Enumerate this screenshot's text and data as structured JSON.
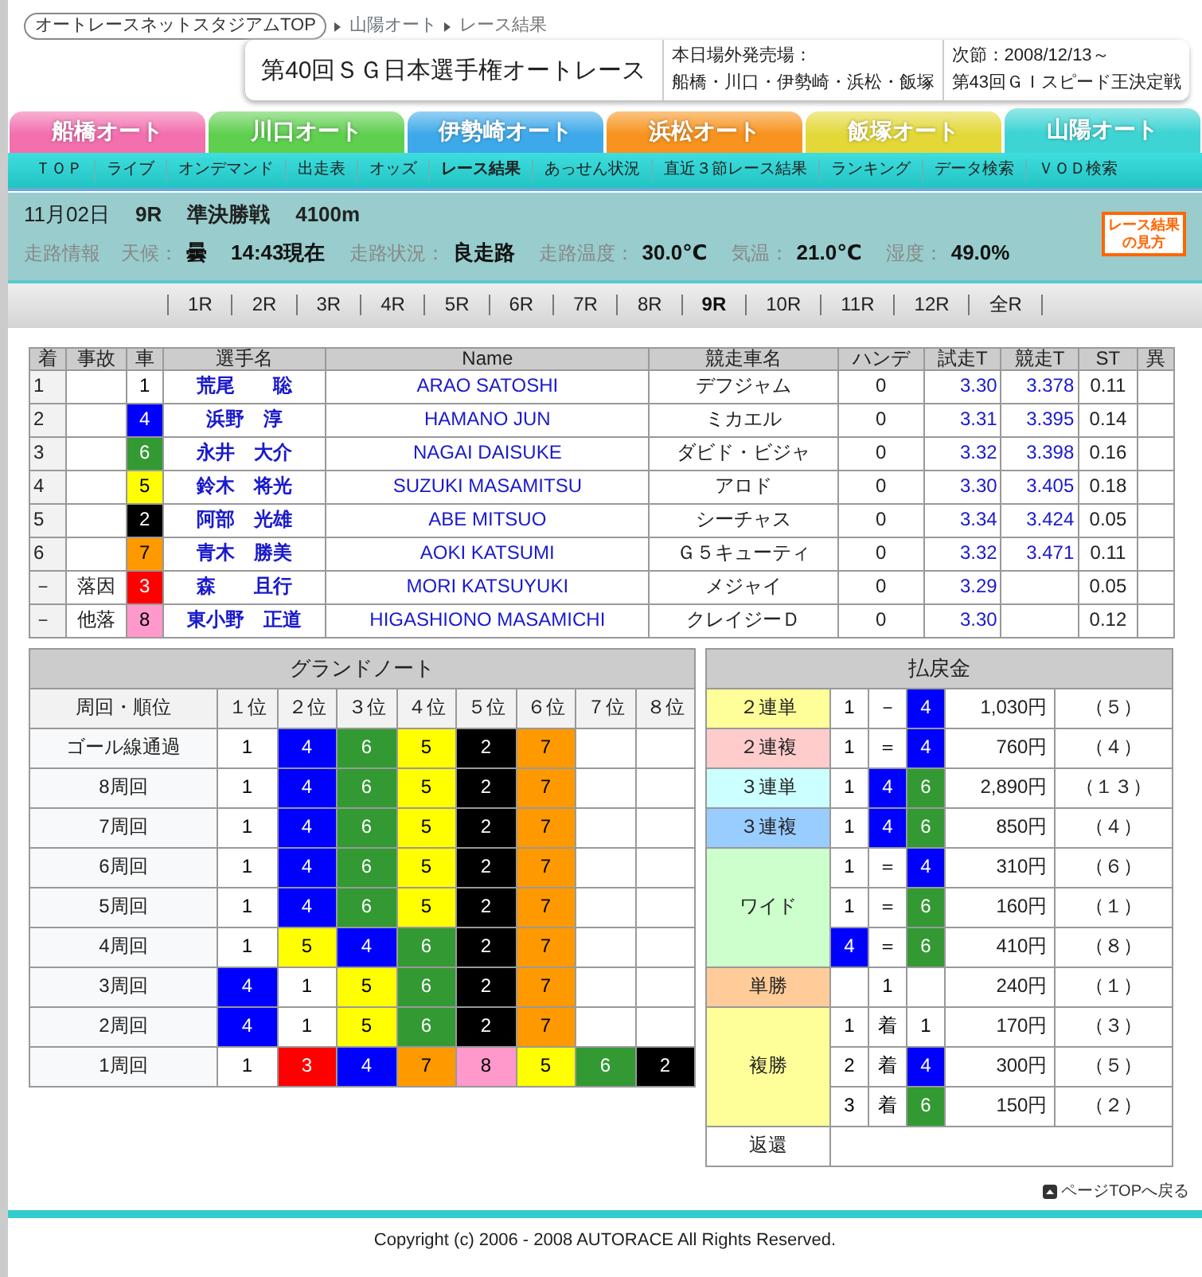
{
  "breadcrumb": [
    "オートレースネットスタジアムTOP",
    "山陽オート",
    "レース結果"
  ],
  "header": {
    "title": "第40回ＳＧ日本選手権オートレース",
    "sales_label": "本日場外発売場：",
    "sales_venues": "船橋・川口・伊勢崎・浜松・飯塚",
    "next_label": "次節：2008/12/13～",
    "next_race": "第43回ＧＩスピード王決定戦"
  },
  "venue_tabs": [
    {
      "label": "船橋オート",
      "color": "#f36fae",
      "selected": false
    },
    {
      "label": "川口オート",
      "color": "#5fcf4f",
      "selected": false
    },
    {
      "label": "伊勢崎オート",
      "color": "#3ea9ea",
      "selected": false
    },
    {
      "label": "浜松オート",
      "color": "#f7931e",
      "selected": false
    },
    {
      "label": "飯塚オート",
      "color": "#e3d838",
      "selected": false
    },
    {
      "label": "山陽オート",
      "color": "#3fd4d4",
      "selected": true
    }
  ],
  "subnav": [
    {
      "label": "ＴＯＰ",
      "selected": false
    },
    {
      "label": "ライブ",
      "selected": false
    },
    {
      "label": "オンデマンド",
      "selected": false
    },
    {
      "label": "出走表",
      "selected": false
    },
    {
      "label": "オッズ",
      "selected": false
    },
    {
      "label": "レース結果",
      "selected": true
    },
    {
      "label": "あっせん状況",
      "selected": false
    },
    {
      "label": "直近３節レース結果",
      "selected": false
    },
    {
      "label": "ランキング",
      "selected": false
    },
    {
      "label": "データ検索",
      "selected": false
    },
    {
      "label": "ＶＯＤ検索",
      "selected": false
    }
  ],
  "race_info": {
    "date": "11月02日",
    "race": "9R",
    "grade": "準決勝戦",
    "distance": "4100m"
  },
  "track_info": {
    "label": "走路情報",
    "items": [
      {
        "kind": "label",
        "text": "天候："
      },
      {
        "kind": "value",
        "text": "曇"
      },
      {
        "kind": "value",
        "text": "14:43現在"
      },
      {
        "kind": "label",
        "text": "走路状況："
      },
      {
        "kind": "value",
        "text": "良走路"
      },
      {
        "kind": "label",
        "text": "走路温度："
      },
      {
        "kind": "value",
        "text": "30.0℃"
      },
      {
        "kind": "label",
        "text": "気温："
      },
      {
        "kind": "value",
        "text": "21.0℃"
      },
      {
        "kind": "label",
        "text": "湿度："
      },
      {
        "kind": "value",
        "text": "49.0%"
      }
    ]
  },
  "guide_button": [
    "レース結果",
    "の見方"
  ],
  "race_tabs": [
    {
      "label": "1R",
      "selected": false
    },
    {
      "label": "2R",
      "selected": false
    },
    {
      "label": "3R",
      "selected": false
    },
    {
      "label": "4R",
      "selected": false
    },
    {
      "label": "5R",
      "selected": false
    },
    {
      "label": "6R",
      "selected": false
    },
    {
      "label": "7R",
      "selected": false
    },
    {
      "label": "8R",
      "selected": false
    },
    {
      "label": "9R",
      "selected": true
    },
    {
      "label": "10R",
      "selected": false
    },
    {
      "label": "11R",
      "selected": false
    },
    {
      "label": "12R",
      "selected": false
    },
    {
      "label": "全R",
      "selected": false
    }
  ],
  "results": {
    "columns": [
      "着",
      "事故",
      "車",
      "選手名",
      "Name",
      "競走車名",
      "ハンデ",
      "試走T",
      "競走T",
      "ST",
      "異"
    ],
    "rows": [
      {
        "finish": "1",
        "car": "1",
        "color": "#ffffff",
        "name_ja": "荒尾　　聡",
        "name_en": "ARAO SATOSHI",
        "bike": "デフジャム",
        "handicap": "0",
        "trial_time": "3.30",
        "race_time": "3.378",
        "st": "0.11"
      },
      {
        "finish": "2",
        "car": "4",
        "color": "#0000ff",
        "name_ja": "浜野　淳",
        "name_en": "HAMANO JUN",
        "bike": "ミカエル",
        "handicap": "0",
        "trial_time": "3.31",
        "race_time": "3.395",
        "st": "0.14"
      },
      {
        "finish": "3",
        "car": "6",
        "color": "#339933",
        "name_ja": "永井　大介",
        "name_en": "NAGAI DAISUKE",
        "bike": "ダビド・ビジャ",
        "handicap": "0",
        "trial_time": "3.32",
        "race_time": "3.398",
        "st": "0.16"
      },
      {
        "finish": "4",
        "car": "5",
        "color": "#ffff00",
        "name_ja": "鈴木　将光",
        "name_en": "SUZUKI MASAMITSU",
        "bike": "アロド",
        "handicap": "0",
        "trial_time": "3.30",
        "race_time": "3.405",
        "st": "0.18"
      },
      {
        "finish": "5",
        "car": "2",
        "color": "#000000",
        "name_ja": "阿部　光雄",
        "name_en": "ABE MITSUO",
        "bike": "シーチャス",
        "handicap": "0",
        "trial_time": "3.34",
        "race_time": "3.424",
        "st": "0.05"
      },
      {
        "finish": "6",
        "car": "7",
        "color": "#ff9900",
        "name_ja": "青木　勝美",
        "name_en": "AOKI KATSUMI",
        "bike": "Ｇ５キューティ",
        "handicap": "0",
        "trial_time": "3.32",
        "race_time": "3.471",
        "st": "0.11"
      },
      {
        "finish": "－",
        "accident": "落因",
        "car": "3",
        "color": "#ff0000",
        "name_ja": "森　　且行",
        "name_en": "MORI KATSUYUKI",
        "bike": "メジャイ",
        "handicap": "0",
        "trial_time": "3.29",
        "st": "0.05"
      },
      {
        "finish": "－",
        "accident": "他落",
        "car": "8",
        "color": "#ff99cc",
        "name_ja": "東小野　正道",
        "name_en": "HIGASHIONO MASAMICHI",
        "bike": "クレイジーＤ",
        "handicap": "0",
        "trial_time": "3.30",
        "st": "0.12"
      }
    ]
  },
  "grand_note": {
    "title": "グランドノート",
    "row_header": "周回・順位",
    "columns": [
      "１位",
      "２位",
      "３位",
      "４位",
      "５位",
      "６位",
      "７位",
      "８位"
    ],
    "rows": [
      {
        "lap": "ゴール線通過",
        "cells": [
          {
            "car": "1",
            "color": "#ffffff"
          },
          {
            "car": "4",
            "color": "#0000ff"
          },
          {
            "car": "6",
            "color": "#339933"
          },
          {
            "car": "5",
            "color": "#ffff00"
          },
          {
            "car": "2",
            "color": "#000000"
          },
          {
            "car": "7",
            "color": "#ff9900"
          }
        ]
      },
      {
        "lap": "8周回",
        "cells": [
          {
            "car": "1",
            "color": "#ffffff"
          },
          {
            "car": "4",
            "color": "#0000ff"
          },
          {
            "car": "6",
            "color": "#339933"
          },
          {
            "car": "5",
            "color": "#ffff00"
          },
          {
            "car": "2",
            "color": "#000000"
          },
          {
            "car": "7",
            "color": "#ff9900"
          }
        ]
      },
      {
        "lap": "7周回",
        "cells": [
          {
            "car": "1",
            "color": "#ffffff"
          },
          {
            "car": "4",
            "color": "#0000ff"
          },
          {
            "car": "6",
            "color": "#339933"
          },
          {
            "car": "5",
            "color": "#ffff00"
          },
          {
            "car": "2",
            "color": "#000000"
          },
          {
            "car": "7",
            "color": "#ff9900"
          }
        ]
      },
      {
        "lap": "6周回",
        "cells": [
          {
            "car": "1",
            "color": "#ffffff"
          },
          {
            "car": "4",
            "color": "#0000ff"
          },
          {
            "car": "6",
            "color": "#339933"
          },
          {
            "car": "5",
            "color": "#ffff00"
          },
          {
            "car": "2",
            "color": "#000000"
          },
          {
            "car": "7",
            "color": "#ff9900"
          }
        ]
      },
      {
        "lap": "5周回",
        "cells": [
          {
            "car": "1",
            "color": "#ffffff"
          },
          {
            "car": "4",
            "color": "#0000ff"
          },
          {
            "car": "6",
            "color": "#339933"
          },
          {
            "car": "5",
            "color": "#ffff00"
          },
          {
            "car": "2",
            "color": "#000000"
          },
          {
            "car": "7",
            "color": "#ff9900"
          }
        ]
      },
      {
        "lap": "4周回",
        "cells": [
          {
            "car": "1",
            "color": "#ffffff"
          },
          {
            "car": "5",
            "color": "#ffff00"
          },
          {
            "car": "4",
            "color": "#0000ff"
          },
          {
            "car": "6",
            "color": "#339933"
          },
          {
            "car": "2",
            "color": "#000000"
          },
          {
            "car": "7",
            "color": "#ff9900"
          }
        ]
      },
      {
        "lap": "3周回",
        "cells": [
          {
            "car": "4",
            "color": "#0000ff"
          },
          {
            "car": "1",
            "color": "#ffffff"
          },
          {
            "car": "5",
            "color": "#ffff00"
          },
          {
            "car": "6",
            "color": "#339933"
          },
          {
            "car": "2",
            "color": "#000000"
          },
          {
            "car": "7",
            "color": "#ff9900"
          }
        ]
      },
      {
        "lap": "2周回",
        "cells": [
          {
            "car": "4",
            "color": "#0000ff"
          },
          {
            "car": "1",
            "color": "#ffffff"
          },
          {
            "car": "5",
            "color": "#ffff00"
          },
          {
            "car": "6",
            "color": "#339933"
          },
          {
            "car": "2",
            "color": "#000000"
          },
          {
            "car": "7",
            "color": "#ff9900"
          }
        ]
      },
      {
        "lap": "1周回",
        "cells": [
          {
            "car": "1",
            "color": "#ffffff"
          },
          {
            "car": "3",
            "color": "#ff0000"
          },
          {
            "car": "4",
            "color": "#0000ff"
          },
          {
            "car": "7",
            "color": "#ff9900"
          },
          {
            "car": "8",
            "color": "#ff99cc"
          },
          {
            "car": "5",
            "color": "#ffff00"
          },
          {
            "car": "6",
            "color": "#339933"
          },
          {
            "car": "2",
            "color": "#000000"
          }
        ]
      }
    ]
  },
  "payout": {
    "title": "払戻金",
    "rows": [
      {
        "bet_type": "２連単",
        "color": "#ffff99",
        "combos": [
          {
            "kind": "triple",
            "cells": [
              {
                "text": "1",
                "color": "#ffffff"
              },
              {
                "text": "－",
                "color": "#ffffff"
              },
              {
                "text": "4",
                "color": "#0000ff"
              }
            ],
            "amount": "1,030円",
            "popularity": "（５）"
          }
        ]
      },
      {
        "bet_type": "２連複",
        "color": "#ffcccc",
        "combos": [
          {
            "kind": "triple",
            "cells": [
              {
                "text": "1",
                "color": "#ffffff"
              },
              {
                "text": "＝",
                "color": "#ffffff"
              },
              {
                "text": "4",
                "color": "#0000ff"
              }
            ],
            "amount": "760円",
            "popularity": "（４）"
          }
        ]
      },
      {
        "bet_type": "３連単",
        "color": "#ccffff",
        "combos": [
          {
            "kind": "triple",
            "cells": [
              {
                "text": "1",
                "color": "#ffffff"
              },
              {
                "text": "4",
                "color": "#0000ff"
              },
              {
                "text": "6",
                "color": "#339933"
              }
            ],
            "amount": "2,890円",
            "popularity": "（１３）"
          }
        ]
      },
      {
        "bet_type": "３連複",
        "color": "#99ccff",
        "combos": [
          {
            "kind": "triple",
            "cells": [
              {
                "text": "1",
                "color": "#ffffff"
              },
              {
                "text": "4",
                "color": "#0000ff"
              },
              {
                "text": "6",
                "color": "#339933"
              }
            ],
            "amount": "850円",
            "popularity": "（４）"
          }
        ]
      },
      {
        "bet_type": "ワイド",
        "color": "#ccffcc",
        "combos": [
          {
            "kind": "triple",
            "cells": [
              {
                "text": "1",
                "color": "#ffffff"
              },
              {
                "text": "＝",
                "color": "#ffffff"
              },
              {
                "text": "4",
                "color": "#0000ff"
              }
            ],
            "amount": "310円",
            "popularity": "（６）"
          },
          {
            "kind": "triple",
            "cells": [
              {
                "text": "1",
                "color": "#ffffff"
              },
              {
                "text": "＝",
                "color": "#ffffff"
              },
              {
                "text": "6",
                "color": "#339933"
              }
            ],
            "amount": "160円",
            "popularity": "（１）"
          },
          {
            "kind": "triple",
            "cells": [
              {
                "text": "4",
                "color": "#0000ff"
              },
              {
                "text": "＝",
                "color": "#ffffff"
              },
              {
                "text": "6",
                "color": "#339933"
              }
            ],
            "amount": "410円",
            "popularity": "（８）"
          }
        ]
      },
      {
        "bet_type": "単勝",
        "color": "#ffcc99",
        "combos": [
          {
            "kind": "single",
            "cells": [
              {
                "text": "1",
                "color": "#ffffff"
              }
            ],
            "amount": "240円",
            "popularity": "（１）"
          }
        ]
      },
      {
        "bet_type": "複勝",
        "color": "#ffff99",
        "combos": [
          {
            "kind": "triple",
            "cells": [
              {
                "text": "1",
                "color": "#ffffff"
              },
              {
                "text": "着",
                "color": "#ffffff"
              },
              {
                "text": "1",
                "color": "#ffffff"
              }
            ],
            "amount": "170円",
            "popularity": "（３）"
          },
          {
            "kind": "triple",
            "cells": [
              {
                "text": "2",
                "color": "#ffffff"
              },
              {
                "text": "着",
                "color": "#ffffff"
              },
              {
                "text": "4",
                "color": "#0000ff"
              }
            ],
            "amount": "300円",
            "popularity": "（５）"
          },
          {
            "kind": "triple",
            "cells": [
              {
                "text": "3",
                "color": "#ffffff"
              },
              {
                "text": "着",
                "color": "#ffffff"
              },
              {
                "text": "6",
                "color": "#339933"
              }
            ],
            "amount": "150円",
            "popularity": "（２）"
          }
        ]
      },
      {
        "bet_type": "返還",
        "color": "#ffffff",
        "combos": []
      }
    ]
  },
  "page_top_link": "ページTOPへ戻る",
  "copyright": "Copyright (c) 2006 - 2008 AUTORACE All Rights Reserved."
}
